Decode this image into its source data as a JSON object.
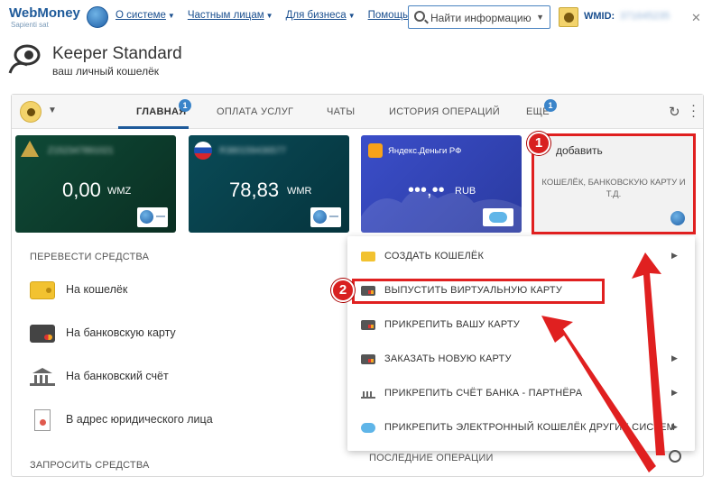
{
  "header": {
    "logo_text": "WebMoney",
    "logo_sub": "Sapienti sat",
    "nav": [
      "О системе",
      "Частным лицам",
      "Для бизнеса",
      "Помощь"
    ],
    "search_placeholder": "Найти информацию",
    "wmid_label": "WMID:",
    "wmid_value": "371645235"
  },
  "keeper": {
    "title": "Keeper Standard",
    "subtitle": "ваш личный кошелёк"
  },
  "tabs": [
    {
      "label": "ГЛАВНАЯ",
      "badge": "1",
      "active": true
    },
    {
      "label": "ОПЛАТА УСЛУГ"
    },
    {
      "label": "ЧАТЫ"
    },
    {
      "label": "ИСТОРИЯ ОПЕРАЦИЙ"
    },
    {
      "label": "ЕЩЕ",
      "badge": "1"
    }
  ],
  "cards": [
    {
      "amount": "0,00",
      "currency": "WMZ",
      "hidden_label": "Z152347891021"
    },
    {
      "amount": "78,83",
      "currency": "WMR",
      "hidden_label": "R380159436577"
    },
    {
      "title": "Яндекс.Деньги РФ",
      "amount": "•••,••",
      "currency": "RUB"
    }
  ],
  "add_card": {
    "title": "добавить",
    "description": "КОШЕЛЁК, БАНКОВСКУЮ КАРТУ И Т.Д."
  },
  "transfer": {
    "title": "ПЕРЕВЕСТИ СРЕДСТВА",
    "items": [
      "На кошелёк",
      "На банковскую карту",
      "На банковский счёт",
      "В адрес юридического лица"
    ]
  },
  "request": {
    "title": "ЗАПРОСИТЬ СРЕДСТВА"
  },
  "menu": {
    "items": [
      {
        "label": "СОЗДАТЬ КОШЕЛЁК",
        "icon": "wallet-icon",
        "arrow": true
      },
      {
        "label": "ВЫПУСТИТЬ ВИРТУАЛЬНУЮ КАРТУ",
        "icon": "card-icon",
        "arrow": false
      },
      {
        "label": "ПРИКРЕПИТЬ ВАШУ КАРТУ",
        "icon": "card-icon",
        "arrow": false
      },
      {
        "label": "ЗАКАЗАТЬ НОВУЮ КАРТУ",
        "icon": "card-icon",
        "arrow": true
      },
      {
        "label": "ПРИКРЕПИТЬ СЧЁТ БАНКА - ПАРТНЁРА",
        "icon": "bank-icon",
        "arrow": true
      },
      {
        "label": "ПРИКРЕПИТЬ ЭЛЕКТРОННЫЙ КОШЕЛЁК ДРУГИХ СИСТЕМ",
        "icon": "cloud-icon",
        "arrow": true
      }
    ]
  },
  "recent_ops": "ПОСЛЕДНИЕ ОПЕРАЦИИ",
  "annotations": {
    "step1": "1",
    "step2": "2",
    "color": "#e02020"
  }
}
